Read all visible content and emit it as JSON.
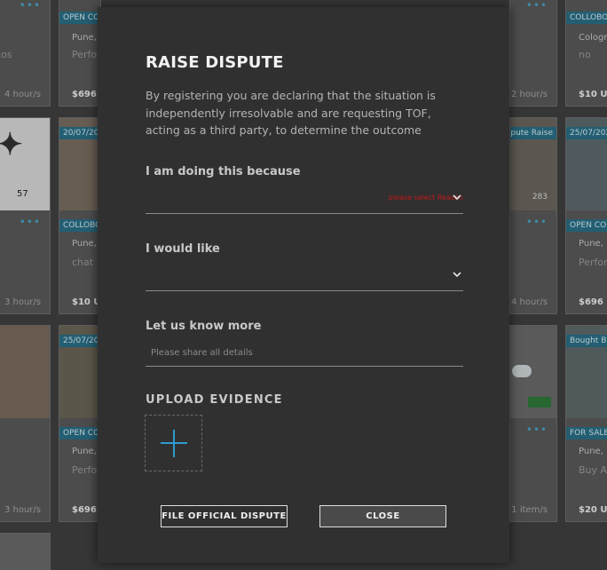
{
  "background_cards": [
    {
      "tag": "OPEN COLLO",
      "line1": "Pune, I",
      "line2": "Perfor",
      "price": "$696 US"
    },
    {
      "line2": "os",
      "meta": "4 hour/s"
    },
    {
      "meta": "2 hour/s"
    },
    {
      "tag": "COLLOBORA",
      "line1": "Cologne",
      "line2": "no",
      "price": "$10 USD"
    },
    {
      "count": "57"
    },
    {
      "date": "20/07/202",
      "tag": "COLLOBOR",
      "line1": "Pune, I",
      "line2": "chat",
      "price": "$10 US"
    },
    {
      "date": "Dispute Raise",
      "count": "283",
      "line2": "os",
      "meta": "4 hour/s"
    },
    {
      "date": "25/07/202",
      "tag": "OPEN COLL",
      "line1": "Pune, I",
      "line2": "Perfor",
      "price": "$696 US"
    },
    {
      "meta": "3 hour/s"
    },
    {
      "date": "25/07/202",
      "tag": "OPEN COLL",
      "line1": "Pune, I",
      "line2": "Perfor",
      "price": "$696 US"
    },
    {
      "meta": "3 hour/s"
    },
    {
      "meta": "1 item/s"
    },
    {
      "date": "Bought By",
      "tag": "FOR SALE",
      "line1": "Pune, In",
      "line2": "Buy Ar",
      "price": "$20 USD"
    }
  ],
  "modal": {
    "title": "RAISE DISPUTE",
    "description": "By registering you are declaring that the situation is independently irresolvable and are requesting TOF, acting as a third party, to determine the outcome",
    "reason_label": "I am doing this because",
    "reason_error": "please select Reason",
    "outcome_label": "I would like",
    "details_label": "Let us know more",
    "details_placeholder": "Please share all details",
    "upload_label": "UPLOAD EVIDENCE",
    "file_button": "FILE OFFICIAL DISPUTE",
    "close_button": "CLOSE"
  },
  "colors": {
    "accent": "#2f9bd1",
    "error": "#c01818",
    "modal_bg": "#303030",
    "tag_bg": "#2a6f86"
  }
}
